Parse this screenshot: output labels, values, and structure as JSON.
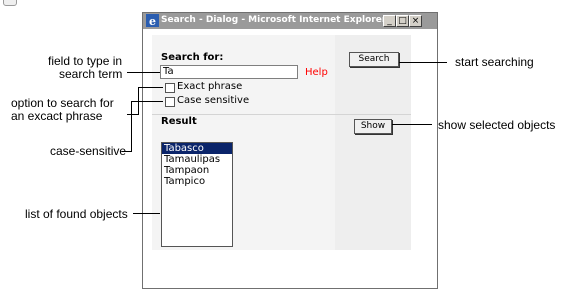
{
  "window": {
    "title": "Search - Dialog - Microsoft Internet Explorer",
    "min_btn": "_",
    "max_btn": "□",
    "close_btn": "×"
  },
  "form": {
    "search_label": "Search for:",
    "search_value": "Ta",
    "help_link": "Help",
    "exact_phrase_label": "Exact phrase",
    "case_sensitive_label": "Case sensitive",
    "search_button": "Search",
    "result_label": "Result",
    "show_button": "Show",
    "results": [
      "Tabasco",
      "Tamaulipas",
      "Tampaon",
      "Tampico"
    ],
    "selected_index": 0
  },
  "annotations": {
    "field_line1": "field to type in",
    "field_line2": "search term",
    "option_line1": "option to search for",
    "option_line2": "an excact phrase",
    "case": "case-sensitive",
    "list": "list of  found objects",
    "start": "start searching",
    "show": "show selected objects"
  }
}
